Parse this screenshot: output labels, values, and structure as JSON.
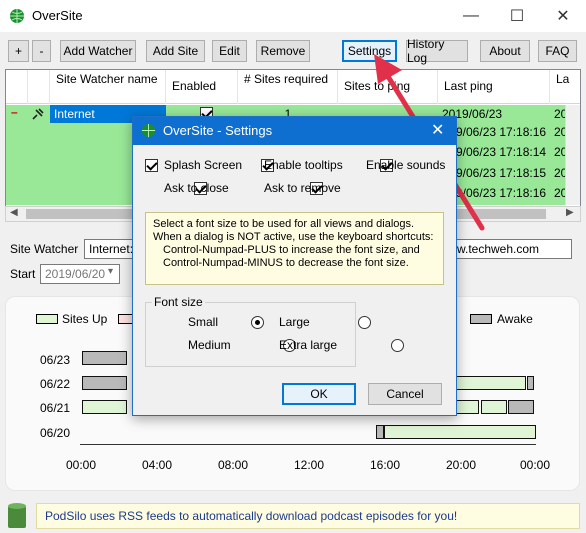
{
  "window": {
    "title": "OverSite"
  },
  "toolbar": {
    "plus": "+",
    "minus": "-",
    "add_watcher": "Add Watcher",
    "add_site": "Add Site",
    "edit": "Edit",
    "remove": "Remove",
    "settings": "Settings",
    "history_log": "History Log",
    "about": "About",
    "faq": "FAQ"
  },
  "grid": {
    "headers": {
      "site_watcher": "Site Watcher name",
      "enabled": "Enabled",
      "sites_required": "# Sites required",
      "sites_to_ping": "Sites to ping",
      "last_ping": "Last ping",
      "la": "La"
    },
    "rows": [
      {
        "name": "Internet",
        "sites_required": "1",
        "last_ping": "2019/06/23 17:18:15",
        "la": "20"
      },
      {
        "name": "",
        "sites_required": "",
        "last_ping": "9/06/23 17:18:16",
        "la": "20"
      },
      {
        "name": "",
        "sites_required": "",
        "last_ping": "9/06/23 17:18:14",
        "la": "20"
      },
      {
        "name": "",
        "sites_required": "",
        "last_ping": "9/06/23 17:18:15",
        "la": "20"
      },
      {
        "name": "",
        "sites_required": "",
        "last_ping": "9/06/23 17:18:16",
        "la": "20"
      }
    ]
  },
  "form": {
    "site_watcher_label": "Site Watcher",
    "site_watcher_value": "Internet: w",
    "url_value": "w.techweh.com",
    "start_label": "Start",
    "start_value": "2019/06/20"
  },
  "chart_data": {
    "type": "bar",
    "legend": [
      "Sites Up",
      "Awake"
    ],
    "categories": [
      "06/23",
      "06/22",
      "06/21",
      "06/20"
    ],
    "x_ticks": [
      "00:00",
      "04:00",
      "08:00",
      "12:00",
      "16:00",
      "20:00",
      "00:00"
    ],
    "xlim": [
      0,
      24
    ],
    "series": [
      {
        "name": "Sites Up",
        "color": "#dff5d5",
        "segments": [
          [],
          [
            [
              19.8,
              23.5
            ]
          ],
          [
            [
              0.1,
              2.5
            ],
            [
              19.8,
              21.0
            ],
            [
              21.1,
              22.5
            ]
          ],
          [
            [
              16.0,
              24.0
            ]
          ]
        ]
      },
      {
        "name": "Awake",
        "color": "#b9b9b9",
        "segments": [
          [
            [
              0.1,
              2.5
            ]
          ],
          [
            [
              0.1,
              2.5
            ],
            [
              23.5,
              23.9
            ]
          ],
          [
            [
              22.5,
              23.9
            ]
          ],
          [
            [
              15.6,
              16.0
            ]
          ]
        ]
      }
    ]
  },
  "status": {
    "text": "PodSilo uses RSS feeds to automatically download podcast episodes for you!"
  },
  "dialog": {
    "title": "OverSite - Settings",
    "checkboxes": {
      "splash_screen": "Splash Screen",
      "enable_tooltips": "Enable tooltips",
      "enable_sounds": "Enable sounds",
      "ask_to_close": "Ask to close",
      "ask_to_remove": "Ask to remove"
    },
    "info": {
      "line1": "Select a font size to be used for all views and dialogs.",
      "line2": "When a dialog is NOT active, use the keyboard shortcuts:",
      "line3": "Control-Numpad-PLUS to increase the font size, and",
      "line4": "Control-Numpad-MINUS to decrease the font size."
    },
    "font_size": {
      "label": "Font size",
      "small": "Small",
      "large": "Large",
      "medium": "Medium",
      "extra_large": "Extra large",
      "selected": "Small"
    },
    "ok": "OK",
    "cancel": "Cancel"
  },
  "colors": {
    "accent": "#0e6fd1",
    "arrow": "#e0304a",
    "grid_green": "#98e898"
  }
}
